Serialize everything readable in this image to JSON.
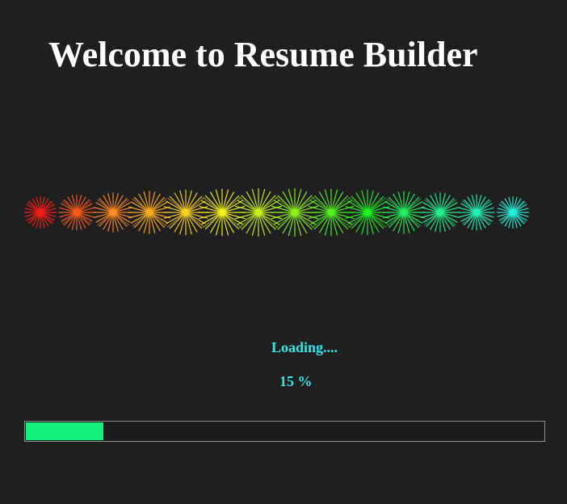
{
  "window": {
    "title": "Welcome to Resume Builder"
  },
  "loader": {
    "status_text": "Loading....",
    "percent_text": "15 %",
    "progress_fraction": 0.15,
    "animation": {
      "type": "starburst-wave",
      "colors": [
        "#ff1a1a",
        "#ff5a1a",
        "#ff8a1f",
        "#ffab1f",
        "#ffd21f",
        "#f6f21b",
        "#c6f21b",
        "#8ff21b",
        "#52f21b",
        "#1ff21f",
        "#1ff25b",
        "#1ff28c",
        "#1ff2b7",
        "#1ff2dd"
      ]
    }
  },
  "colors": {
    "background": "#1f1f1f",
    "title": "#ffffff",
    "status_text": "#33e6ea",
    "progress_fill": "#12f07f",
    "progress_border": "#8f8f8f"
  }
}
